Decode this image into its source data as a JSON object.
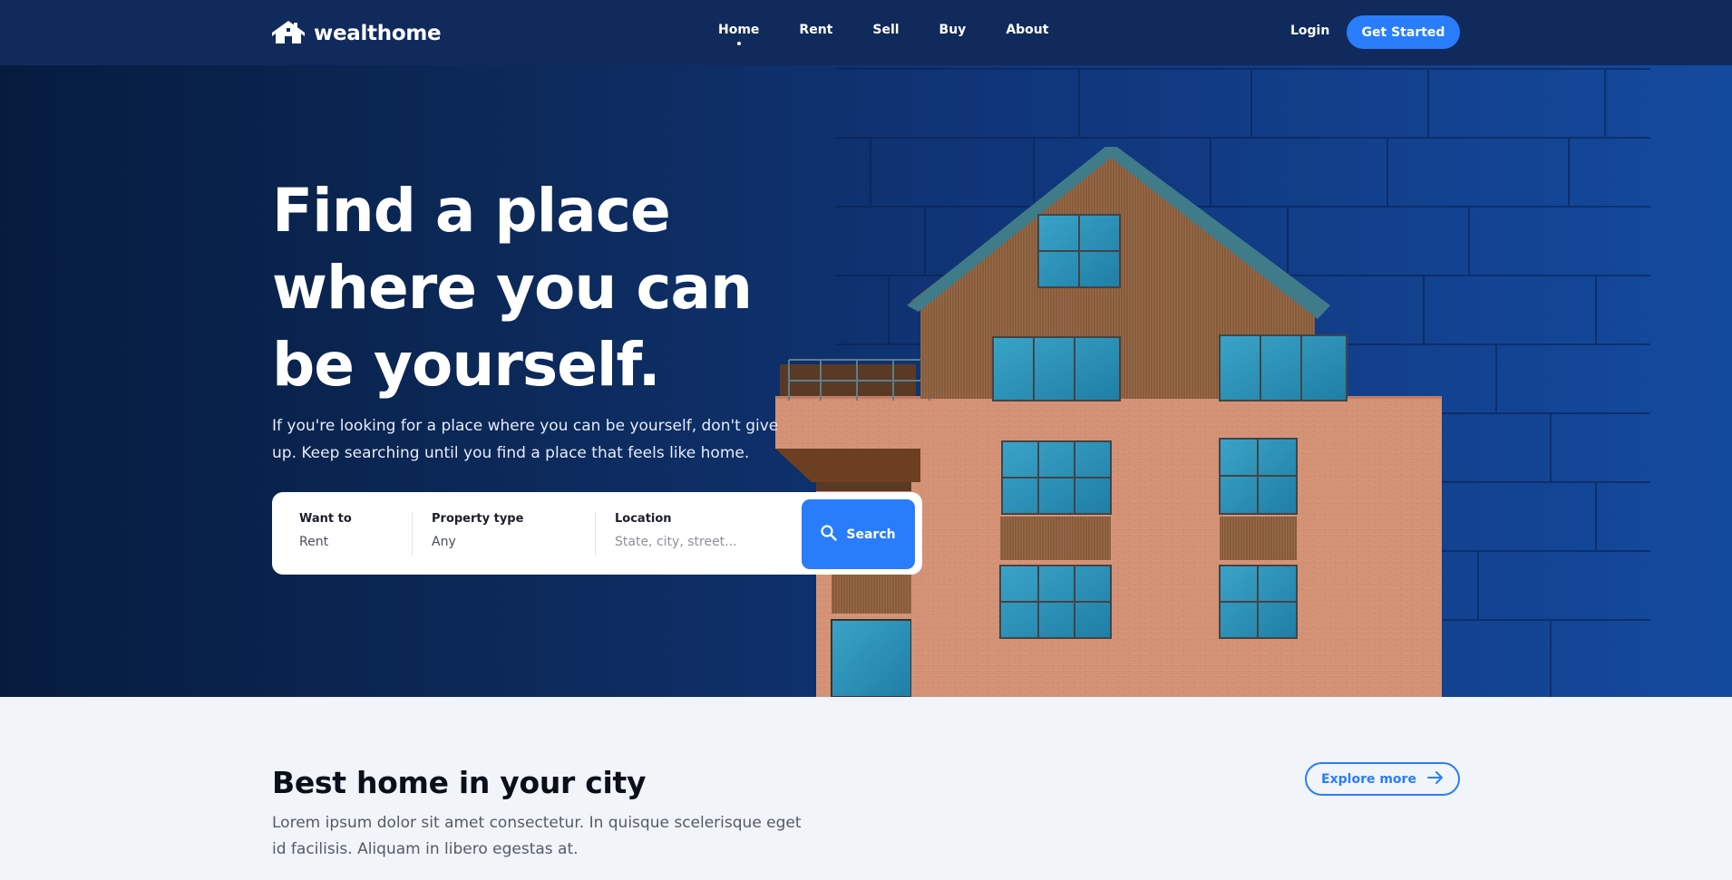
{
  "brand": {
    "name": "wealthome",
    "icon": "house-logo-icon"
  },
  "nav": {
    "links": [
      {
        "label": "Home",
        "active": true
      },
      {
        "label": "Rent"
      },
      {
        "label": "Sell"
      },
      {
        "label": "Buy"
      },
      {
        "label": "About"
      }
    ],
    "login_label": "Login",
    "cta_label": "Get Started"
  },
  "hero": {
    "title_lines": [
      "Find a place",
      "where you can",
      "be yourself."
    ],
    "subtitle_lines": [
      "If you're looking for a place where you can be yourself, don't give",
      "up. Keep searching until you find a place that feels like home."
    ]
  },
  "search": {
    "want_to": {
      "label": "Want to",
      "value": "Rent"
    },
    "property_type": {
      "label": "Property type",
      "value": "Any"
    },
    "location": {
      "label": "Location",
      "placeholder": "State, city, street..."
    },
    "button_label": "Search",
    "button_icon": "search-icon"
  },
  "section": {
    "title": "Best home in your city",
    "description_lines": [
      "Lorem ipsum dolor sit amet consectetur. In quisque scelerisque eget",
      "id facilisis. Aliquam in libero egestas at."
    ],
    "explore_label": "Explore more",
    "explore_icon": "arrow-right-icon"
  },
  "colors": {
    "nav_bg": "#112a5c",
    "accent": "#2a7dfa",
    "hero_dark": "#061c3f",
    "hero_light": "#144a9e",
    "section_bg": "#f1f4f9"
  }
}
